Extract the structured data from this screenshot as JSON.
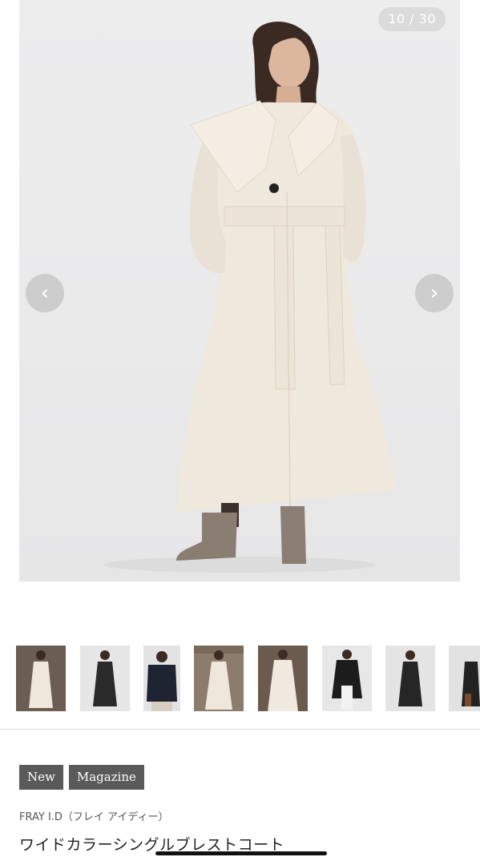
{
  "gallery": {
    "counter": "10 / 30",
    "prev_icon": "chevron-left-icon",
    "next_icon": "chevron-right-icon"
  },
  "thumbnails": [
    {
      "name": "thumb-1-cream-coat"
    },
    {
      "name": "thumb-2-black-coat"
    },
    {
      "name": "thumb-3-black-blouse"
    },
    {
      "name": "thumb-4-cream-coat"
    },
    {
      "name": "thumb-5-cream-coat"
    },
    {
      "name": "thumb-6-black-coat-white-pants"
    },
    {
      "name": "thumb-7-black-coat"
    },
    {
      "name": "thumb-8-partial"
    }
  ],
  "tags": [
    "New",
    "Magazine"
  ],
  "product": {
    "brand": "FRAY I.D（フレイ アイディー）",
    "title": "ワイドカラーシングルブレストコート"
  }
}
